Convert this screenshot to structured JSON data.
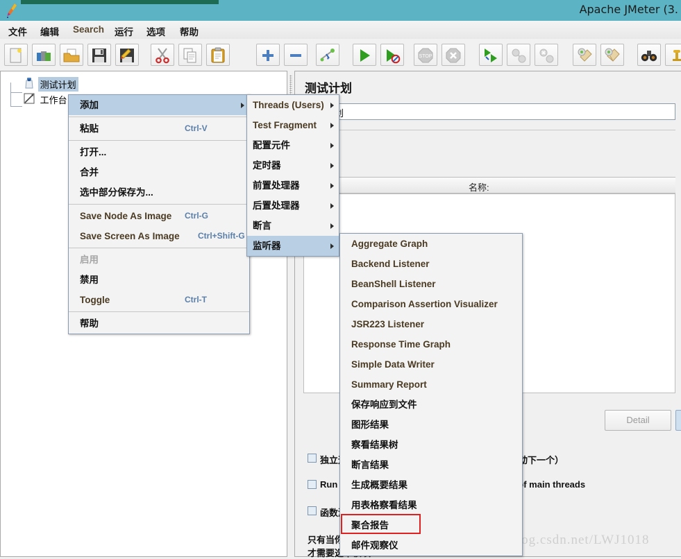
{
  "window": {
    "title": "Apache JMeter (3.",
    "logo_icon": "jmeter-feather-icon",
    "titlebar_color": "#5bb3c4",
    "accent_strip_color": "#1c6b52"
  },
  "menubar": {
    "items": [
      {
        "label": "文件",
        "lang": "zh"
      },
      {
        "label": "编辑",
        "lang": "zh"
      },
      {
        "label": "Search",
        "lang": "en"
      },
      {
        "label": "运行",
        "lang": "zh"
      },
      {
        "label": "选项",
        "lang": "zh"
      },
      {
        "label": "帮助",
        "lang": "zh"
      }
    ]
  },
  "toolbar": {
    "buttons": [
      {
        "icon": "new-document-icon",
        "enabled": true
      },
      {
        "icon": "templates-icon",
        "enabled": true
      },
      {
        "icon": "open-folder-icon",
        "enabled": true
      },
      {
        "icon": "save-icon",
        "enabled": true
      },
      {
        "icon": "save-as-icon",
        "enabled": true
      },
      {
        "icon": "cut-scissors-icon",
        "enabled": true
      },
      {
        "icon": "copy-icon",
        "enabled": true
      },
      {
        "icon": "paste-clipboard-icon",
        "enabled": true
      },
      {
        "icon": "expand-all-plus-icon",
        "enabled": true
      },
      {
        "icon": "collapse-all-minus-icon",
        "enabled": true
      },
      {
        "icon": "toggle-icon",
        "enabled": true
      },
      {
        "icon": "start-play-icon",
        "enabled": true
      },
      {
        "icon": "start-no-pauses-icon",
        "enabled": true
      },
      {
        "icon": "stop-icon",
        "enabled": false
      },
      {
        "icon": "shutdown-icon",
        "enabled": false
      },
      {
        "icon": "remote-start-all-icon",
        "enabled": true
      },
      {
        "icon": "remote-stop-all-icon",
        "enabled": false
      },
      {
        "icon": "remote-shutdown-all-icon",
        "enabled": false
      },
      {
        "icon": "clear-icon",
        "enabled": true
      },
      {
        "icon": "clear-all-icon",
        "enabled": true
      },
      {
        "icon": "search-binoculars-icon",
        "enabled": true
      },
      {
        "icon": "function-helper-icon",
        "enabled": true
      }
    ]
  },
  "tree": {
    "nodes": [
      {
        "label": "测试计划",
        "icon": "test-plan-icon",
        "selected": true
      },
      {
        "label": "工作台",
        "icon": "workbench-icon",
        "selected": false
      }
    ]
  },
  "right_panel": {
    "title": "测试计划",
    "name_field_value": "测试计划",
    "table_header": "名称:",
    "detail_button": "Detail",
    "checkboxes": [
      {
        "label": "独立运行每个线程组（例如在一个组运行结束后启动下一个）",
        "checked": false
      },
      {
        "label": "Run tearDown Thread Groups after shutdown of main threads",
        "checked": false
      },
      {
        "label": "函数测试模式",
        "checked": false
      }
    ],
    "notes": [
      "只有当你需要记录每个请求到文件时",
      "才需要选中该项"
    ]
  },
  "context_menu": {
    "items": [
      {
        "label": "添加",
        "accel": "",
        "submenu": true,
        "selected": true,
        "lang": "zh"
      },
      {
        "sep": true
      },
      {
        "label": "粘贴",
        "accel": "Ctrl-V",
        "lang": "zh"
      },
      {
        "sep": true
      },
      {
        "label": "打开...",
        "accel": "",
        "lang": "zh"
      },
      {
        "label": "合并",
        "accel": "",
        "lang": "zh"
      },
      {
        "label": "选中部分保存为...",
        "accel": "",
        "lang": "zh"
      },
      {
        "sep": true
      },
      {
        "label": "Save Node As Image",
        "accel": "Ctrl-G",
        "lang": "en"
      },
      {
        "label": "Save Screen As Image",
        "accel": "Ctrl+Shift-G",
        "lang": "en"
      },
      {
        "sep": true
      },
      {
        "label": "启用",
        "accel": "",
        "disabled": true,
        "lang": "zh"
      },
      {
        "label": "禁用",
        "accel": "",
        "lang": "zh"
      },
      {
        "label": "Toggle",
        "accel": "Ctrl-T",
        "lang": "en"
      },
      {
        "sep": true
      },
      {
        "label": "帮助",
        "accel": "",
        "lang": "zh"
      }
    ]
  },
  "add_menu": {
    "items": [
      {
        "label": "Threads (Users)",
        "submenu": true,
        "lang": "en"
      },
      {
        "label": "Test Fragment",
        "submenu": true,
        "lang": "en"
      },
      {
        "label": "配置元件",
        "submenu": true,
        "lang": "zh"
      },
      {
        "label": "定时器",
        "submenu": true,
        "lang": "zh"
      },
      {
        "label": "前置处理器",
        "submenu": true,
        "lang": "zh"
      },
      {
        "label": "后置处理器",
        "submenu": true,
        "lang": "zh"
      },
      {
        "label": "断言",
        "submenu": true,
        "lang": "zh"
      },
      {
        "label": "监听器",
        "submenu": true,
        "selected": true,
        "lang": "zh"
      }
    ]
  },
  "listener_menu": {
    "items": [
      {
        "label": "Aggregate Graph",
        "lang": "en"
      },
      {
        "label": "Backend Listener",
        "lang": "en"
      },
      {
        "label": "BeanShell Listener",
        "lang": "en"
      },
      {
        "label": "Comparison Assertion Visualizer",
        "lang": "en"
      },
      {
        "label": "JSR223 Listener",
        "lang": "en"
      },
      {
        "label": "Response Time Graph",
        "lang": "en"
      },
      {
        "label": "Simple Data Writer",
        "lang": "en"
      },
      {
        "label": "Summary Report",
        "lang": "en"
      },
      {
        "label": "保存响应到文件",
        "lang": "zh"
      },
      {
        "label": "图形结果",
        "lang": "zh"
      },
      {
        "label": "察看结果树",
        "lang": "zh"
      },
      {
        "label": "断言结果",
        "lang": "zh"
      },
      {
        "label": "生成概要结果",
        "lang": "zh"
      },
      {
        "label": "用表格察看结果",
        "lang": "zh"
      },
      {
        "label": "聚合报告",
        "lang": "zh",
        "highlighted_box": true
      },
      {
        "label": "邮件观察仪",
        "lang": "zh"
      }
    ]
  },
  "annotation": {
    "red_box_target": "聚合报告",
    "red_box_color": "#e02020"
  },
  "watermark": {
    "text": "http://blog.csdn.net/LWJ1018"
  }
}
